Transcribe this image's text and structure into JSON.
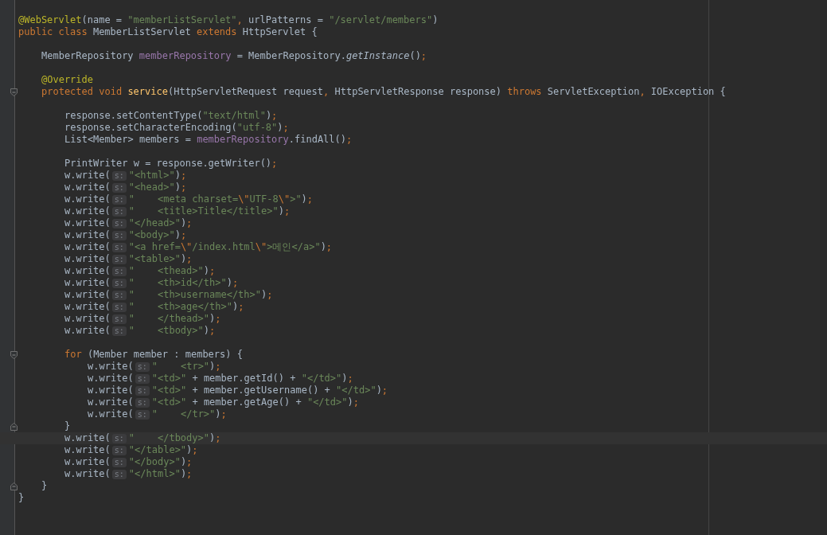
{
  "editor": {
    "lines": [
      {
        "current": false,
        "tokens": [
          {
            "kind": "annotation",
            "text": "@WebServlet"
          },
          {
            "kind": "plain",
            "text": "(name = "
          },
          {
            "kind": "string",
            "text": "\"memberListServlet\""
          },
          {
            "kind": "punct",
            "text": ", "
          },
          {
            "kind": "plain",
            "text": "urlPatterns = "
          },
          {
            "kind": "string",
            "text": "\"/servlet/members\""
          },
          {
            "kind": "plain",
            "text": ")"
          }
        ]
      },
      {
        "current": false,
        "tokens": [
          {
            "kind": "keyword",
            "text": "public class "
          },
          {
            "kind": "plain",
            "text": "MemberListServlet "
          },
          {
            "kind": "keyword",
            "text": "extends "
          },
          {
            "kind": "plain",
            "text": "HttpServlet {"
          }
        ],
        "children": [
          {
            "current": false
          },
          {
            "current": false,
            "tokens": [
              {
                "kind": "plain",
                "text": "MemberRepository "
              },
              {
                "kind": "field",
                "text": "memberRepository"
              },
              {
                "kind": "plain",
                "text": " = MemberRepository."
              },
              {
                "kind": "italic",
                "text": "getInstance"
              },
              {
                "kind": "plain",
                "text": "()"
              },
              {
                "kind": "punct",
                "text": ";"
              }
            ]
          },
          {
            "current": false
          },
          {
            "current": false,
            "tokens": [
              {
                "kind": "annotation",
                "text": "@Override"
              }
            ]
          },
          {
            "current": false,
            "expanded": true,
            "tokens": [
              {
                "kind": "keyword",
                "text": "protected void "
              },
              {
                "kind": "method",
                "text": "service"
              },
              {
                "kind": "plain",
                "text": "(HttpServletRequest request"
              },
              {
                "kind": "punct",
                "text": ", "
              },
              {
                "kind": "plain",
                "text": "HttpServletResponse response) "
              },
              {
                "kind": "keyword",
                "text": "throws "
              },
              {
                "kind": "plain",
                "text": "ServletException"
              },
              {
                "kind": "punct",
                "text": ", "
              },
              {
                "kind": "plain",
                "text": "IOException {"
              }
            ],
            "children": [
              {
                "current": false
              },
              {
                "current": false,
                "tokens": [
                  {
                    "kind": "plain",
                    "text": "response.setContentType("
                  },
                  {
                    "kind": "string",
                    "text": "\"text/html\""
                  },
                  {
                    "kind": "plain",
                    "text": ")"
                  },
                  {
                    "kind": "punct",
                    "text": ";"
                  }
                ]
              },
              {
                "current": false,
                "tokens": [
                  {
                    "kind": "plain",
                    "text": "response.setCharacterEncoding("
                  },
                  {
                    "kind": "string",
                    "text": "\"utf-8\""
                  },
                  {
                    "kind": "plain",
                    "text": ")"
                  },
                  {
                    "kind": "punct",
                    "text": ";"
                  }
                ]
              },
              {
                "current": false,
                "tokens": [
                  {
                    "kind": "plain",
                    "text": "List<Member> members = "
                  },
                  {
                    "kind": "field",
                    "text": "memberRepository"
                  },
                  {
                    "kind": "plain",
                    "text": ".findAll()"
                  },
                  {
                    "kind": "punct",
                    "text": ";"
                  }
                ]
              },
              {
                "current": false
              },
              {
                "current": false,
                "tokens": [
                  {
                    "kind": "plain",
                    "text": "PrintWriter w = response.getWriter()"
                  },
                  {
                    "kind": "punct",
                    "text": ";"
                  }
                ]
              },
              {
                "current": false,
                "tokens": [
                  {
                    "kind": "plain",
                    "text": "w.write("
                  },
                  {
                    "kind": "hint",
                    "text": "s:"
                  },
                  {
                    "kind": "string",
                    "text": "\"<html>\""
                  },
                  {
                    "kind": "plain",
                    "text": ")"
                  },
                  {
                    "kind": "punct",
                    "text": ";"
                  }
                ]
              },
              {
                "current": false,
                "tokens": [
                  {
                    "kind": "plain",
                    "text": "w.write("
                  },
                  {
                    "kind": "hint",
                    "text": "s:"
                  },
                  {
                    "kind": "string",
                    "text": "\"<head>\""
                  },
                  {
                    "kind": "plain",
                    "text": ")"
                  },
                  {
                    "kind": "punct",
                    "text": ";"
                  }
                ]
              },
              {
                "current": false,
                "tokens": [
                  {
                    "kind": "plain",
                    "text": "w.write("
                  },
                  {
                    "kind": "hint",
                    "text": "s:"
                  },
                  {
                    "kind": "string",
                    "text": "\"    <meta charset="
                  },
                  {
                    "kind": "escape",
                    "text": "\\\""
                  },
                  {
                    "kind": "string",
                    "text": "UTF-8"
                  },
                  {
                    "kind": "escape",
                    "text": "\\\""
                  },
                  {
                    "kind": "string",
                    "text": ">\""
                  },
                  {
                    "kind": "plain",
                    "text": ")"
                  },
                  {
                    "kind": "punct",
                    "text": ";"
                  }
                ]
              },
              {
                "current": false,
                "tokens": [
                  {
                    "kind": "plain",
                    "text": "w.write("
                  },
                  {
                    "kind": "hint",
                    "text": "s:"
                  },
                  {
                    "kind": "string",
                    "text": "\"    <title>Title</title>\""
                  },
                  {
                    "kind": "plain",
                    "text": ")"
                  },
                  {
                    "kind": "punct",
                    "text": ";"
                  }
                ]
              },
              {
                "current": false,
                "tokens": [
                  {
                    "kind": "plain",
                    "text": "w.write("
                  },
                  {
                    "kind": "hint",
                    "text": "s:"
                  },
                  {
                    "kind": "string",
                    "text": "\"</head>\""
                  },
                  {
                    "kind": "plain",
                    "text": ")"
                  },
                  {
                    "kind": "punct",
                    "text": ";"
                  }
                ]
              },
              {
                "current": false,
                "tokens": [
                  {
                    "kind": "plain",
                    "text": "w.write("
                  },
                  {
                    "kind": "hint",
                    "text": "s:"
                  },
                  {
                    "kind": "string",
                    "text": "\"<body>\""
                  },
                  {
                    "kind": "plain",
                    "text": ")"
                  },
                  {
                    "kind": "punct",
                    "text": ";"
                  }
                ]
              },
              {
                "current": false,
                "tokens": [
                  {
                    "kind": "plain",
                    "text": "w.write("
                  },
                  {
                    "kind": "hint",
                    "text": "s:"
                  },
                  {
                    "kind": "string",
                    "text": "\"<a href="
                  },
                  {
                    "kind": "escape",
                    "text": "\\\""
                  },
                  {
                    "kind": "string",
                    "text": "/index.html"
                  },
                  {
                    "kind": "escape",
                    "text": "\\\""
                  },
                  {
                    "kind": "string",
                    "text": ">메인</a>\""
                  },
                  {
                    "kind": "plain",
                    "text": ")"
                  },
                  {
                    "kind": "punct",
                    "text": ";"
                  }
                ]
              },
              {
                "current": false,
                "tokens": [
                  {
                    "kind": "plain",
                    "text": "w.write("
                  },
                  {
                    "kind": "hint",
                    "text": "s:"
                  },
                  {
                    "kind": "string",
                    "text": "\"<table>\""
                  },
                  {
                    "kind": "plain",
                    "text": ")"
                  },
                  {
                    "kind": "punct",
                    "text": ";"
                  }
                ]
              },
              {
                "current": false,
                "tokens": [
                  {
                    "kind": "plain",
                    "text": "w.write("
                  },
                  {
                    "kind": "hint",
                    "text": "s:"
                  },
                  {
                    "kind": "string",
                    "text": "\"    <thead>\""
                  },
                  {
                    "kind": "plain",
                    "text": ")"
                  },
                  {
                    "kind": "punct",
                    "text": ";"
                  }
                ]
              },
              {
                "current": false,
                "tokens": [
                  {
                    "kind": "plain",
                    "text": "w.write("
                  },
                  {
                    "kind": "hint",
                    "text": "s:"
                  },
                  {
                    "kind": "string",
                    "text": "\"    <th>id</th>\""
                  },
                  {
                    "kind": "plain",
                    "text": ")"
                  },
                  {
                    "kind": "punct",
                    "text": ";"
                  }
                ]
              },
              {
                "current": false,
                "tokens": [
                  {
                    "kind": "plain",
                    "text": "w.write("
                  },
                  {
                    "kind": "hint",
                    "text": "s:"
                  },
                  {
                    "kind": "string",
                    "text": "\"    <th>username</th>\""
                  },
                  {
                    "kind": "plain",
                    "text": ")"
                  },
                  {
                    "kind": "punct",
                    "text": ";"
                  }
                ]
              },
              {
                "current": false,
                "tokens": [
                  {
                    "kind": "plain",
                    "text": "w.write("
                  },
                  {
                    "kind": "hint",
                    "text": "s:"
                  },
                  {
                    "kind": "string",
                    "text": "\"    <th>age</th>\""
                  },
                  {
                    "kind": "plain",
                    "text": ")"
                  },
                  {
                    "kind": "punct",
                    "text": ";"
                  }
                ]
              },
              {
                "current": false,
                "tokens": [
                  {
                    "kind": "plain",
                    "text": "w.write("
                  },
                  {
                    "kind": "hint",
                    "text": "s:"
                  },
                  {
                    "kind": "string",
                    "text": "\"    </thead>\""
                  },
                  {
                    "kind": "plain",
                    "text": ")"
                  },
                  {
                    "kind": "punct",
                    "text": ";"
                  }
                ]
              },
              {
                "current": false,
                "tokens": [
                  {
                    "kind": "plain",
                    "text": "w.write("
                  },
                  {
                    "kind": "hint",
                    "text": "s:"
                  },
                  {
                    "kind": "string",
                    "text": "\"    <tbody>\""
                  },
                  {
                    "kind": "plain",
                    "text": ")"
                  },
                  {
                    "kind": "punct",
                    "text": ";"
                  }
                ]
              },
              {
                "current": false
              },
              {
                "current": false,
                "expanded": true,
                "tokens": [
                  {
                    "kind": "keyword",
                    "text": "for "
                  },
                  {
                    "kind": "plain",
                    "text": "(Member member : members) {"
                  }
                ],
                "children": [
                  {
                    "current": false,
                    "tokens": [
                      {
                        "kind": "plain",
                        "text": "w.write("
                      },
                      {
                        "kind": "hint",
                        "text": "s:"
                      },
                      {
                        "kind": "string",
                        "text": "\"    <tr>\""
                      },
                      {
                        "kind": "plain",
                        "text": ")"
                      },
                      {
                        "kind": "punct",
                        "text": ";"
                      }
                    ]
                  },
                  {
                    "current": false,
                    "tokens": [
                      {
                        "kind": "plain",
                        "text": "w.write("
                      },
                      {
                        "kind": "hint",
                        "text": "s:"
                      },
                      {
                        "kind": "string",
                        "text": "\"<td>\""
                      },
                      {
                        "kind": "plain",
                        "text": " + member.getId() + "
                      },
                      {
                        "kind": "string",
                        "text": "\"</td>\""
                      },
                      {
                        "kind": "plain",
                        "text": ")"
                      },
                      {
                        "kind": "punct",
                        "text": ";"
                      }
                    ]
                  },
                  {
                    "current": false,
                    "tokens": [
                      {
                        "kind": "plain",
                        "text": "w.write("
                      },
                      {
                        "kind": "hint",
                        "text": "s:"
                      },
                      {
                        "kind": "string",
                        "text": "\"<td>\""
                      },
                      {
                        "kind": "plain",
                        "text": " + member.getUsername() + "
                      },
                      {
                        "kind": "string",
                        "text": "\"</td>\""
                      },
                      {
                        "kind": "plain",
                        "text": ")"
                      },
                      {
                        "kind": "punct",
                        "text": ";"
                      }
                    ]
                  },
                  {
                    "current": false,
                    "tokens": [
                      {
                        "kind": "plain",
                        "text": "w.write("
                      },
                      {
                        "kind": "hint",
                        "text": "s:"
                      },
                      {
                        "kind": "string",
                        "text": "\"<td>\""
                      },
                      {
                        "kind": "plain",
                        "text": " + member.getAge() + "
                      },
                      {
                        "kind": "string",
                        "text": "\"</td>\""
                      },
                      {
                        "kind": "plain",
                        "text": ")"
                      },
                      {
                        "kind": "punct",
                        "text": ";"
                      }
                    ]
                  },
                  {
                    "current": false,
                    "tokens": [
                      {
                        "kind": "plain",
                        "text": "w.write("
                      },
                      {
                        "kind": "hint",
                        "text": "s:"
                      },
                      {
                        "kind": "string",
                        "text": "\"    </tr>\""
                      },
                      {
                        "kind": "plain",
                        "text": ")"
                      },
                      {
                        "kind": "punct",
                        "text": ";"
                      }
                    ]
                  }
                ]
              },
              {
                "current": false,
                "tokens": [
                  {
                    "kind": "plain",
                    "text": "}"
                  }
                ]
              },
              {
                "current": true,
                "tokens": [
                  {
                    "kind": "plain",
                    "text": "w.write("
                  },
                  {
                    "kind": "hint",
                    "text": "s:"
                  },
                  {
                    "kind": "string",
                    "text": "\"    </tbody>\""
                  },
                  {
                    "kind": "plain",
                    "text": ")"
                  },
                  {
                    "kind": "punct",
                    "text": ";"
                  }
                ]
              },
              {
                "current": false,
                "tokens": [
                  {
                    "kind": "plain",
                    "text": "w.write("
                  },
                  {
                    "kind": "hint",
                    "text": "s:"
                  },
                  {
                    "kind": "string",
                    "text": "\"</table>\""
                  },
                  {
                    "kind": "plain",
                    "text": ")"
                  },
                  {
                    "kind": "punct",
                    "text": ";"
                  }
                ]
              },
              {
                "current": false,
                "tokens": [
                  {
                    "kind": "plain",
                    "text": "w.write("
                  },
                  {
                    "kind": "hint",
                    "text": "s:"
                  },
                  {
                    "kind": "string",
                    "text": "\"</body>\""
                  },
                  {
                    "kind": "plain",
                    "text": ")"
                  },
                  {
                    "kind": "punct",
                    "text": ";"
                  }
                ]
              },
              {
                "current": false,
                "tokens": [
                  {
                    "kind": "plain",
                    "text": "w.write("
                  },
                  {
                    "kind": "hint",
                    "text": "s:"
                  },
                  {
                    "kind": "string",
                    "text": "\"</html>\""
                  },
                  {
                    "kind": "plain",
                    "text": ")"
                  },
                  {
                    "kind": "punct",
                    "text": ";"
                  }
                ]
              }
            ]
          },
          {
            "current": false,
            "tokens": [
              {
                "kind": "plain",
                "text": "}"
              }
            ]
          }
        ]
      },
      {
        "current": false,
        "tokens": [
          {
            "kind": "plain",
            "text": "}"
          }
        ]
      }
    ]
  }
}
